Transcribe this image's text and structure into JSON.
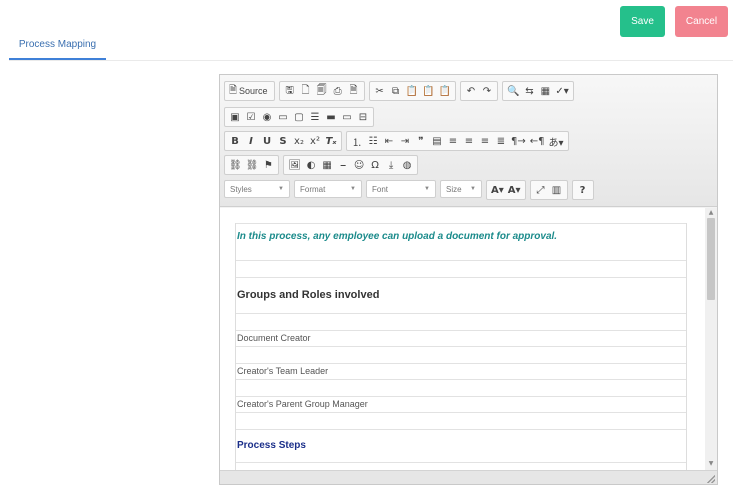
{
  "tabs": [
    {
      "label": "Process Mapping",
      "active": true
    }
  ],
  "actions": {
    "save_label": "Save",
    "cancel_label": "Cancel",
    "save_color": "#25c08b",
    "cancel_color": "#f2838f"
  },
  "toolbar": {
    "row1": [
      [
        {
          "icon": "source-icon",
          "glyph": "🗎",
          "label": "Source"
        }
      ],
      [
        {
          "icon": "save-doc-icon",
          "glyph": "🖫"
        },
        {
          "icon": "new-page-icon",
          "glyph": "🗋"
        },
        {
          "icon": "preview-icon",
          "glyph": "🗐"
        },
        {
          "icon": "print-icon",
          "glyph": "⎙"
        },
        {
          "icon": "templates-icon",
          "glyph": "🗎"
        }
      ],
      [
        {
          "icon": "cut-icon",
          "glyph": "✂"
        },
        {
          "icon": "copy-icon",
          "glyph": "⧉"
        },
        {
          "icon": "paste-icon",
          "glyph": "📋"
        },
        {
          "icon": "paste-text-icon",
          "glyph": "📋"
        },
        {
          "icon": "paste-word-icon",
          "glyph": "📋"
        }
      ],
      [
        {
          "icon": "undo-icon",
          "glyph": "↶"
        },
        {
          "icon": "redo-icon",
          "glyph": "↷"
        }
      ],
      [
        {
          "icon": "find-icon",
          "glyph": "🔍"
        },
        {
          "icon": "replace-icon",
          "glyph": "⇆"
        },
        {
          "icon": "select-all-icon",
          "glyph": "▦"
        },
        {
          "icon": "spellcheck-icon",
          "glyph": "✓▾"
        }
      ]
    ],
    "row2": [
      [
        {
          "icon": "form-icon",
          "glyph": "▣"
        },
        {
          "icon": "checkbox-icon",
          "glyph": "☑"
        },
        {
          "icon": "radio-icon",
          "glyph": "◉"
        },
        {
          "icon": "textfield-icon",
          "glyph": "▭"
        },
        {
          "icon": "textarea-icon",
          "glyph": "▢"
        },
        {
          "icon": "select-icon",
          "glyph": "☰"
        },
        {
          "icon": "button-icon",
          "glyph": "▬"
        },
        {
          "icon": "image-button-icon",
          "glyph": "▭"
        },
        {
          "icon": "hidden-field-icon",
          "glyph": "⊟"
        }
      ]
    ],
    "row3": [
      [
        {
          "icon": "bold-icon",
          "glyph": "B",
          "cls": "bold"
        },
        {
          "icon": "italic-icon",
          "glyph": "I",
          "cls": "ital"
        },
        {
          "icon": "underline-icon",
          "glyph": "U",
          "cls": "bold"
        },
        {
          "icon": "strike-icon",
          "glyph": "S",
          "cls": "bold"
        },
        {
          "icon": "subscript-icon",
          "glyph": "x₂"
        },
        {
          "icon": "superscript-icon",
          "glyph": "x²"
        },
        {
          "icon": "remove-format-icon",
          "glyph": "Tₓ",
          "cls": "ital"
        }
      ],
      [
        {
          "icon": "numbered-list-icon",
          "glyph": "⒈"
        },
        {
          "icon": "bulleted-list-icon",
          "glyph": "☷"
        },
        {
          "icon": "outdent-icon",
          "glyph": "⇤"
        },
        {
          "icon": "indent-icon",
          "glyph": "⇥"
        },
        {
          "icon": "blockquote-icon",
          "glyph": "❞"
        },
        {
          "icon": "div-icon",
          "glyph": "▤"
        },
        {
          "icon": "align-left-icon",
          "glyph": "≡"
        },
        {
          "icon": "align-center-icon",
          "glyph": "≡"
        },
        {
          "icon": "align-right-icon",
          "glyph": "≡"
        },
        {
          "icon": "justify-icon",
          "glyph": "≣"
        },
        {
          "icon": "ltr-icon",
          "glyph": "¶→"
        },
        {
          "icon": "rtl-icon",
          "glyph": "←¶"
        },
        {
          "icon": "language-icon",
          "glyph": "あ▾"
        }
      ]
    ],
    "row4": [
      [
        {
          "icon": "link-icon",
          "glyph": "⛓"
        },
        {
          "icon": "unlink-icon",
          "glyph": "⛓"
        },
        {
          "icon": "anchor-icon",
          "glyph": "⚑"
        }
      ],
      [
        {
          "icon": "image-icon",
          "glyph": "🖼"
        },
        {
          "icon": "flash-icon",
          "glyph": "◐"
        },
        {
          "icon": "table-icon",
          "glyph": "▦"
        },
        {
          "icon": "horizontal-line-icon",
          "glyph": "⎯"
        },
        {
          "icon": "smiley-icon",
          "glyph": "☺"
        },
        {
          "icon": "special-char-icon",
          "glyph": "Ω"
        },
        {
          "icon": "page-break-icon",
          "glyph": "⤓"
        },
        {
          "icon": "iframe-icon",
          "glyph": "◍"
        }
      ]
    ],
    "row5": {
      "combos": [
        {
          "label": "Styles",
          "name": "styles-combo"
        },
        {
          "label": "Format",
          "name": "format-combo"
        },
        {
          "label": "Font",
          "name": "font-combo"
        },
        {
          "label": "Size",
          "name": "size-combo"
        }
      ],
      "groups": [
        [
          {
            "icon": "text-color-icon",
            "glyph": "A▾",
            "cls": "bold"
          },
          {
            "icon": "bg-color-icon",
            "glyph": "A▾",
            "cls": "bold"
          }
        ],
        [
          {
            "icon": "maximize-icon",
            "glyph": "⤢"
          },
          {
            "icon": "show-blocks-icon",
            "glyph": "▥"
          }
        ],
        [
          {
            "icon": "help-icon",
            "glyph": "?",
            "cls": "bold"
          }
        ]
      ]
    }
  },
  "document": {
    "intro": "In this process, any employee can upload a document for approval.",
    "heading": "Groups and Roles involved",
    "roles": [
      "Document Creator",
      "Creator's Team Leader",
      "Creator's Parent Group Manager"
    ],
    "steps_heading": "Process Steps"
  },
  "colors": {
    "accent": "#3f80d8",
    "intro_text": "#1b8b8b",
    "steps_text": "#1b2f8a"
  }
}
